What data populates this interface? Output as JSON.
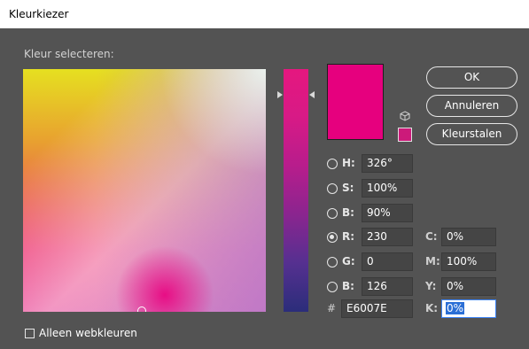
{
  "window": {
    "title": "Kleurkiezer"
  },
  "picker": {
    "section_label": "Kleur selecteren:"
  },
  "buttons": {
    "ok": "OK",
    "cancel": "Annuleren",
    "swatches": "Kleurstalen"
  },
  "colors": {
    "new": "#e6007e",
    "web_safe": "#cc1a7a",
    "accent": "#2b6fd6"
  },
  "hsb": [
    {
      "label": "H:",
      "value": "326°",
      "selected": false
    },
    {
      "label": "S:",
      "value": "100%",
      "selected": false
    },
    {
      "label": "B:",
      "value": "90%",
      "selected": false
    }
  ],
  "rgb": [
    {
      "label": "R:",
      "value": "230",
      "selected": true
    },
    {
      "label": "G:",
      "value": "0",
      "selected": false
    },
    {
      "label": "B:",
      "value": "126",
      "selected": false
    }
  ],
  "cmyk": [
    {
      "label": "C:",
      "value": "0%"
    },
    {
      "label": "M:",
      "value": "100%"
    },
    {
      "label": "Y:",
      "value": "0%"
    },
    {
      "label": "K:",
      "value": "0%"
    }
  ],
  "hex": {
    "label": "#",
    "value": "E6007E"
  },
  "web_only": {
    "label": "Alleen webkleuren",
    "checked": false
  }
}
